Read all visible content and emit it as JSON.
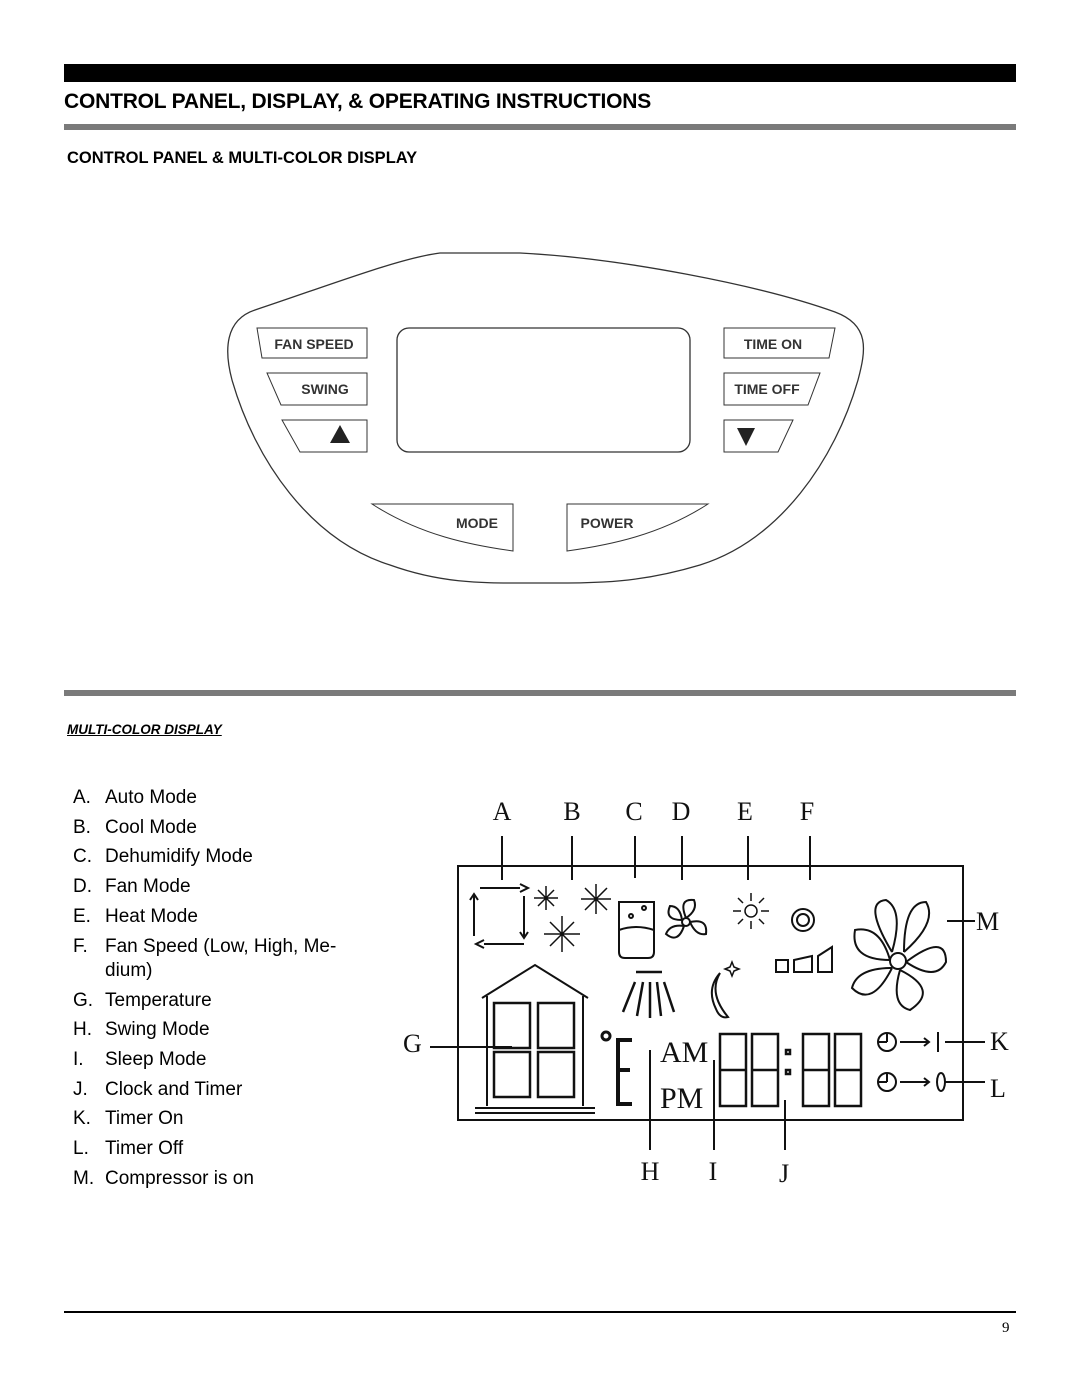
{
  "header": {
    "title": "CONTROL PANEL, DISPLAY, & OPERATING INSTRUCTIONS",
    "subtitle": "CONTROL PANEL & MULTI-COLOR DISPLAY"
  },
  "control_panel": {
    "buttons": {
      "fan_speed": "FAN SPEED",
      "swing": "SWING",
      "up": "up-arrow-icon",
      "time_on": "TIME ON",
      "time_off": "TIME OFF",
      "down": "down-arrow-icon",
      "mode": "MODE",
      "power": "POWER"
    }
  },
  "display_section": {
    "heading": "MULTI-COLOR DISPLAY",
    "legend": [
      {
        "key": "A.",
        "label": "Auto Mode"
      },
      {
        "key": "B.",
        "label": "Cool Mode"
      },
      {
        "key": "C.",
        "label": "Dehumidify Mode"
      },
      {
        "key": "D.",
        "label": "Fan Mode"
      },
      {
        "key": "E.",
        "label": "Heat Mode"
      },
      {
        "key": "F.",
        "label": "Fan Speed (Low, High, Me- dium)"
      },
      {
        "key": "G.",
        "label": "Temperature"
      },
      {
        "key": "H.",
        "label": "Swing Mode"
      },
      {
        "key": "I.",
        "label": "Sleep Mode"
      },
      {
        "key": "J.",
        "label": "Clock and Timer"
      },
      {
        "key": "K.",
        "label": "Timer On"
      },
      {
        "key": "L.",
        "label": "Timer Off"
      },
      {
        "key": "M.",
        "label": "Compressor is on"
      }
    ],
    "diagram_letters": {
      "A": "A",
      "B": "B",
      "C": "C",
      "D": "D",
      "E": "E",
      "F": "F",
      "G": "G",
      "H": "H",
      "I": "I",
      "J": "J",
      "K": "K",
      "L": "L",
      "M": "M"
    },
    "lcd_text": {
      "am": "AM",
      "pm": "PM",
      "unit": "E"
    }
  },
  "footer": {
    "page_number": "9"
  }
}
